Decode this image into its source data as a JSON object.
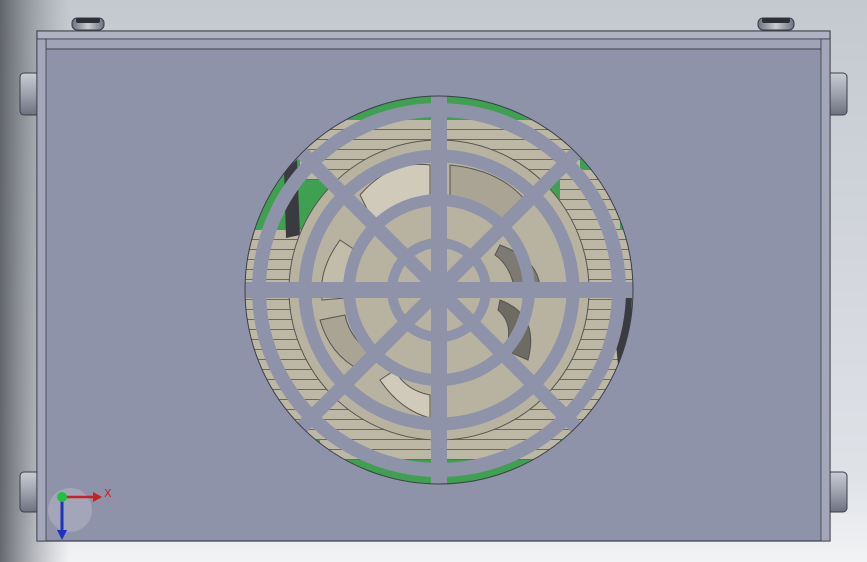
{
  "viewport": {
    "background_top": "#b9bec6",
    "background_bottom": "#eef0f3",
    "background_left_shadow": "#5c5f66"
  },
  "model": {
    "panel_color": "#8c91a8",
    "edge_color": "#3c3e46",
    "vent_grill_color": "#8c91a8",
    "pcb_color": "#3fa052",
    "fan_blade_color": "#bdb8a6",
    "fan_dark_color": "#6e6b63",
    "ring_count": 4,
    "spoke_count": 8,
    "feet": [
      "top-left",
      "top-right",
      "left-upper",
      "left-lower",
      "right-upper",
      "right-lower"
    ]
  },
  "triad": {
    "x_label": "X",
    "x_color": "#cc2020",
    "y_color": "#20a030",
    "z_color": "#2030c0",
    "origin_color": "#20c040"
  }
}
